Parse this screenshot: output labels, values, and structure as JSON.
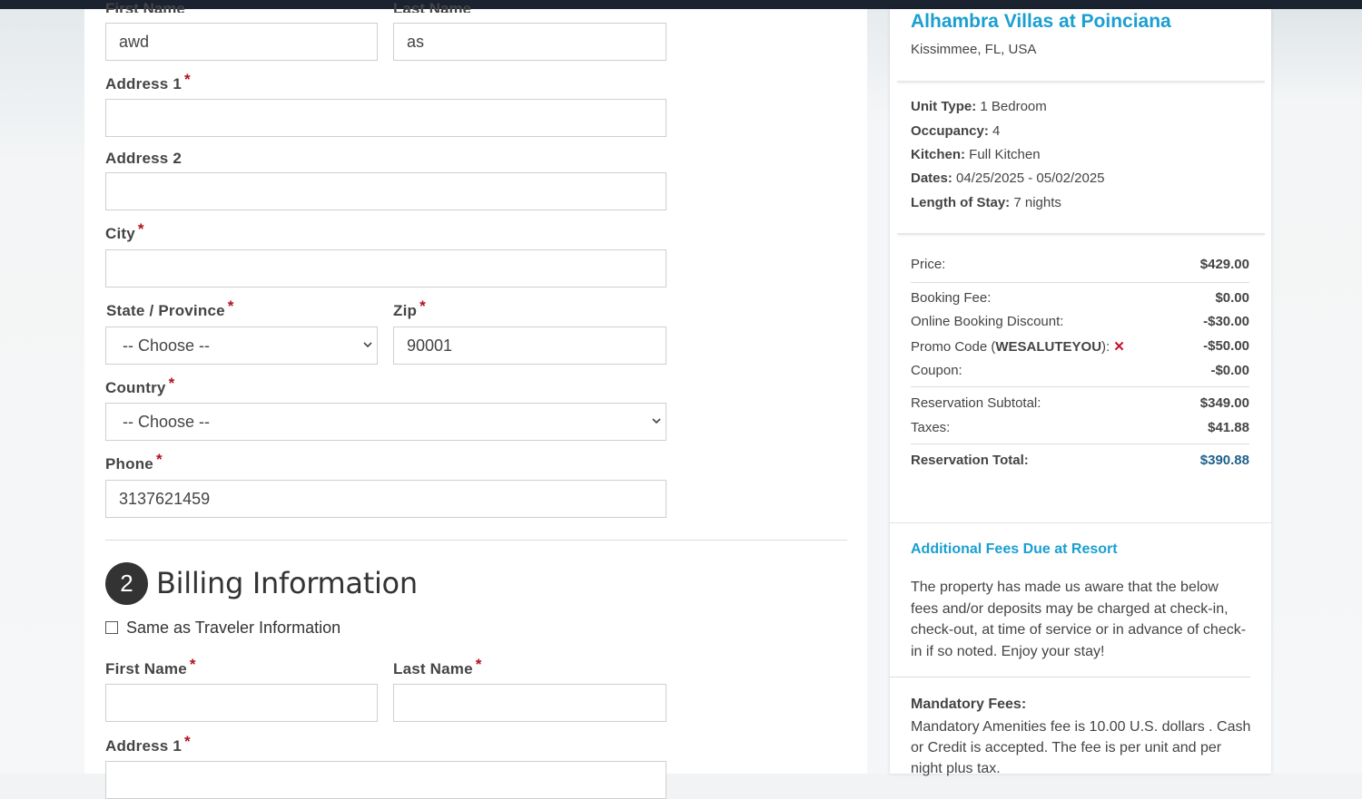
{
  "traveler": {
    "first_name_label": "First Name",
    "last_name_label": "Last Name",
    "first_name_value": "awd",
    "last_name_value": "as",
    "address1_label": "Address 1",
    "address2_label": "Address 2",
    "city_label": "City",
    "state_label": "State / Province",
    "state_value": "-- Choose --",
    "zip_label": "Zip",
    "zip_value": "90001",
    "country_label": "Country",
    "country_value": "-- Choose --",
    "phone_label": "Phone",
    "phone_value": "3137621459",
    "required_mark": "*"
  },
  "billing": {
    "step_number": "2",
    "title": "Billing Information",
    "same_as_label": "Same as Traveler Information",
    "first_name_label": "First Name",
    "last_name_label": "Last Name",
    "address1_label": "Address 1"
  },
  "summary": {
    "resort_name": "Alhambra Villas at Poinciana",
    "location": "Kissimmee, FL, USA",
    "details": [
      {
        "key": "Unit Type:",
        "value": "1 Bedroom"
      },
      {
        "key": "Occupancy:",
        "value": "4"
      },
      {
        "key": "Kitchen:",
        "value": "Full Kitchen"
      },
      {
        "key": "Dates:",
        "value": "04/25/2025 - 05/02/2025"
      },
      {
        "key": "Length of Stay:",
        "value": "7 nights"
      }
    ],
    "price_label": "Price:",
    "price_value": "$429.00",
    "booking_fee_label": "Booking Fee:",
    "booking_fee_value": "$0.00",
    "online_discount_label": "Online Booking Discount:",
    "online_discount_value": "-$30.00",
    "promo_prefix": "Promo Code (",
    "promo_code": "WESALUTEYOU",
    "promo_suffix": "):",
    "promo_remove_icon": "✕",
    "promo_value": "-$50.00",
    "coupon_label": "Coupon:",
    "coupon_value": "-$0.00",
    "subtotal_label": "Reservation Subtotal:",
    "subtotal_value": "$349.00",
    "taxes_label": "Taxes:",
    "taxes_value": "$41.88",
    "total_label": "Reservation Total:",
    "total_value": "$390.88",
    "additional_title": "Additional Fees Due at Resort",
    "additional_text": "The property has made us aware that the below fees and/or deposits may be charged at check-in, check-out, at time of service or in advance of check-in if so noted. Enjoy your stay!",
    "mandatory_title": "Mandatory Fees:",
    "mandatory_text": "Mandatory Amenities fee is 10.00 U.S. dollars . Cash or Credit is accepted. The fee is per unit and per night plus tax."
  },
  "colors": {
    "accent": "#1a9fd1",
    "required": "#b1121d",
    "total": "#1f5f8b",
    "promo_remove": "#c8102e"
  }
}
